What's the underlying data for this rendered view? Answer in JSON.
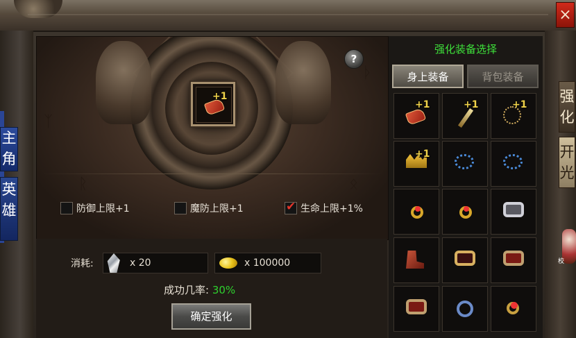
{
  "window": {
    "close_label": "×"
  },
  "left_tabs": {
    "tab1": "主角",
    "tab2": "英雄"
  },
  "right_tabs": {
    "tab1": "强化",
    "tab2": "开光"
  },
  "help": {
    "label": "?"
  },
  "center_item": {
    "enhance": "+1",
    "icon": "gauntlet-icon"
  },
  "attributes": [
    {
      "label": "防御上限+1",
      "checked": false
    },
    {
      "label": "魔防上限+1",
      "checked": false
    },
    {
      "label": "生命上限+1%",
      "checked": true
    }
  ],
  "cost": {
    "label": "消耗:",
    "crystal": {
      "icon": "crystal-icon",
      "qty": "x 20"
    },
    "gold": {
      "icon": "gold-icon",
      "qty": "x 100000"
    }
  },
  "success": {
    "label": "成功几率:",
    "value": "30%"
  },
  "confirm_label": "确定强化",
  "equip_panel": {
    "title": "强化装备选择",
    "tab_worn": "身上装备",
    "tab_bag": "背包装备",
    "items": [
      {
        "icon": "gauntlet-icon",
        "plus": "+1"
      },
      {
        "icon": "wand-icon",
        "plus": "+1"
      },
      {
        "icon": "necklace-icon",
        "plus": "+1"
      },
      {
        "icon": "crown-icon",
        "plus": "+1"
      },
      {
        "icon": "bead-necklace-icon",
        "plus": ""
      },
      {
        "icon": "bead-necklace-icon",
        "plus": ""
      },
      {
        "icon": "ring-icon",
        "plus": ""
      },
      {
        "icon": "ring-icon",
        "plus": ""
      },
      {
        "icon": "silver-bracer-icon",
        "plus": ""
      },
      {
        "icon": "boots-icon",
        "plus": ""
      },
      {
        "icon": "amulet-icon",
        "plus": ""
      },
      {
        "icon": "bracer-icon",
        "plus": ""
      },
      {
        "icon": "bracer-icon",
        "plus": ""
      },
      {
        "icon": "orb-icon",
        "plus": ""
      },
      {
        "icon": "ruby-ring-icon",
        "plus": ""
      }
    ]
  },
  "npc_label": "校"
}
